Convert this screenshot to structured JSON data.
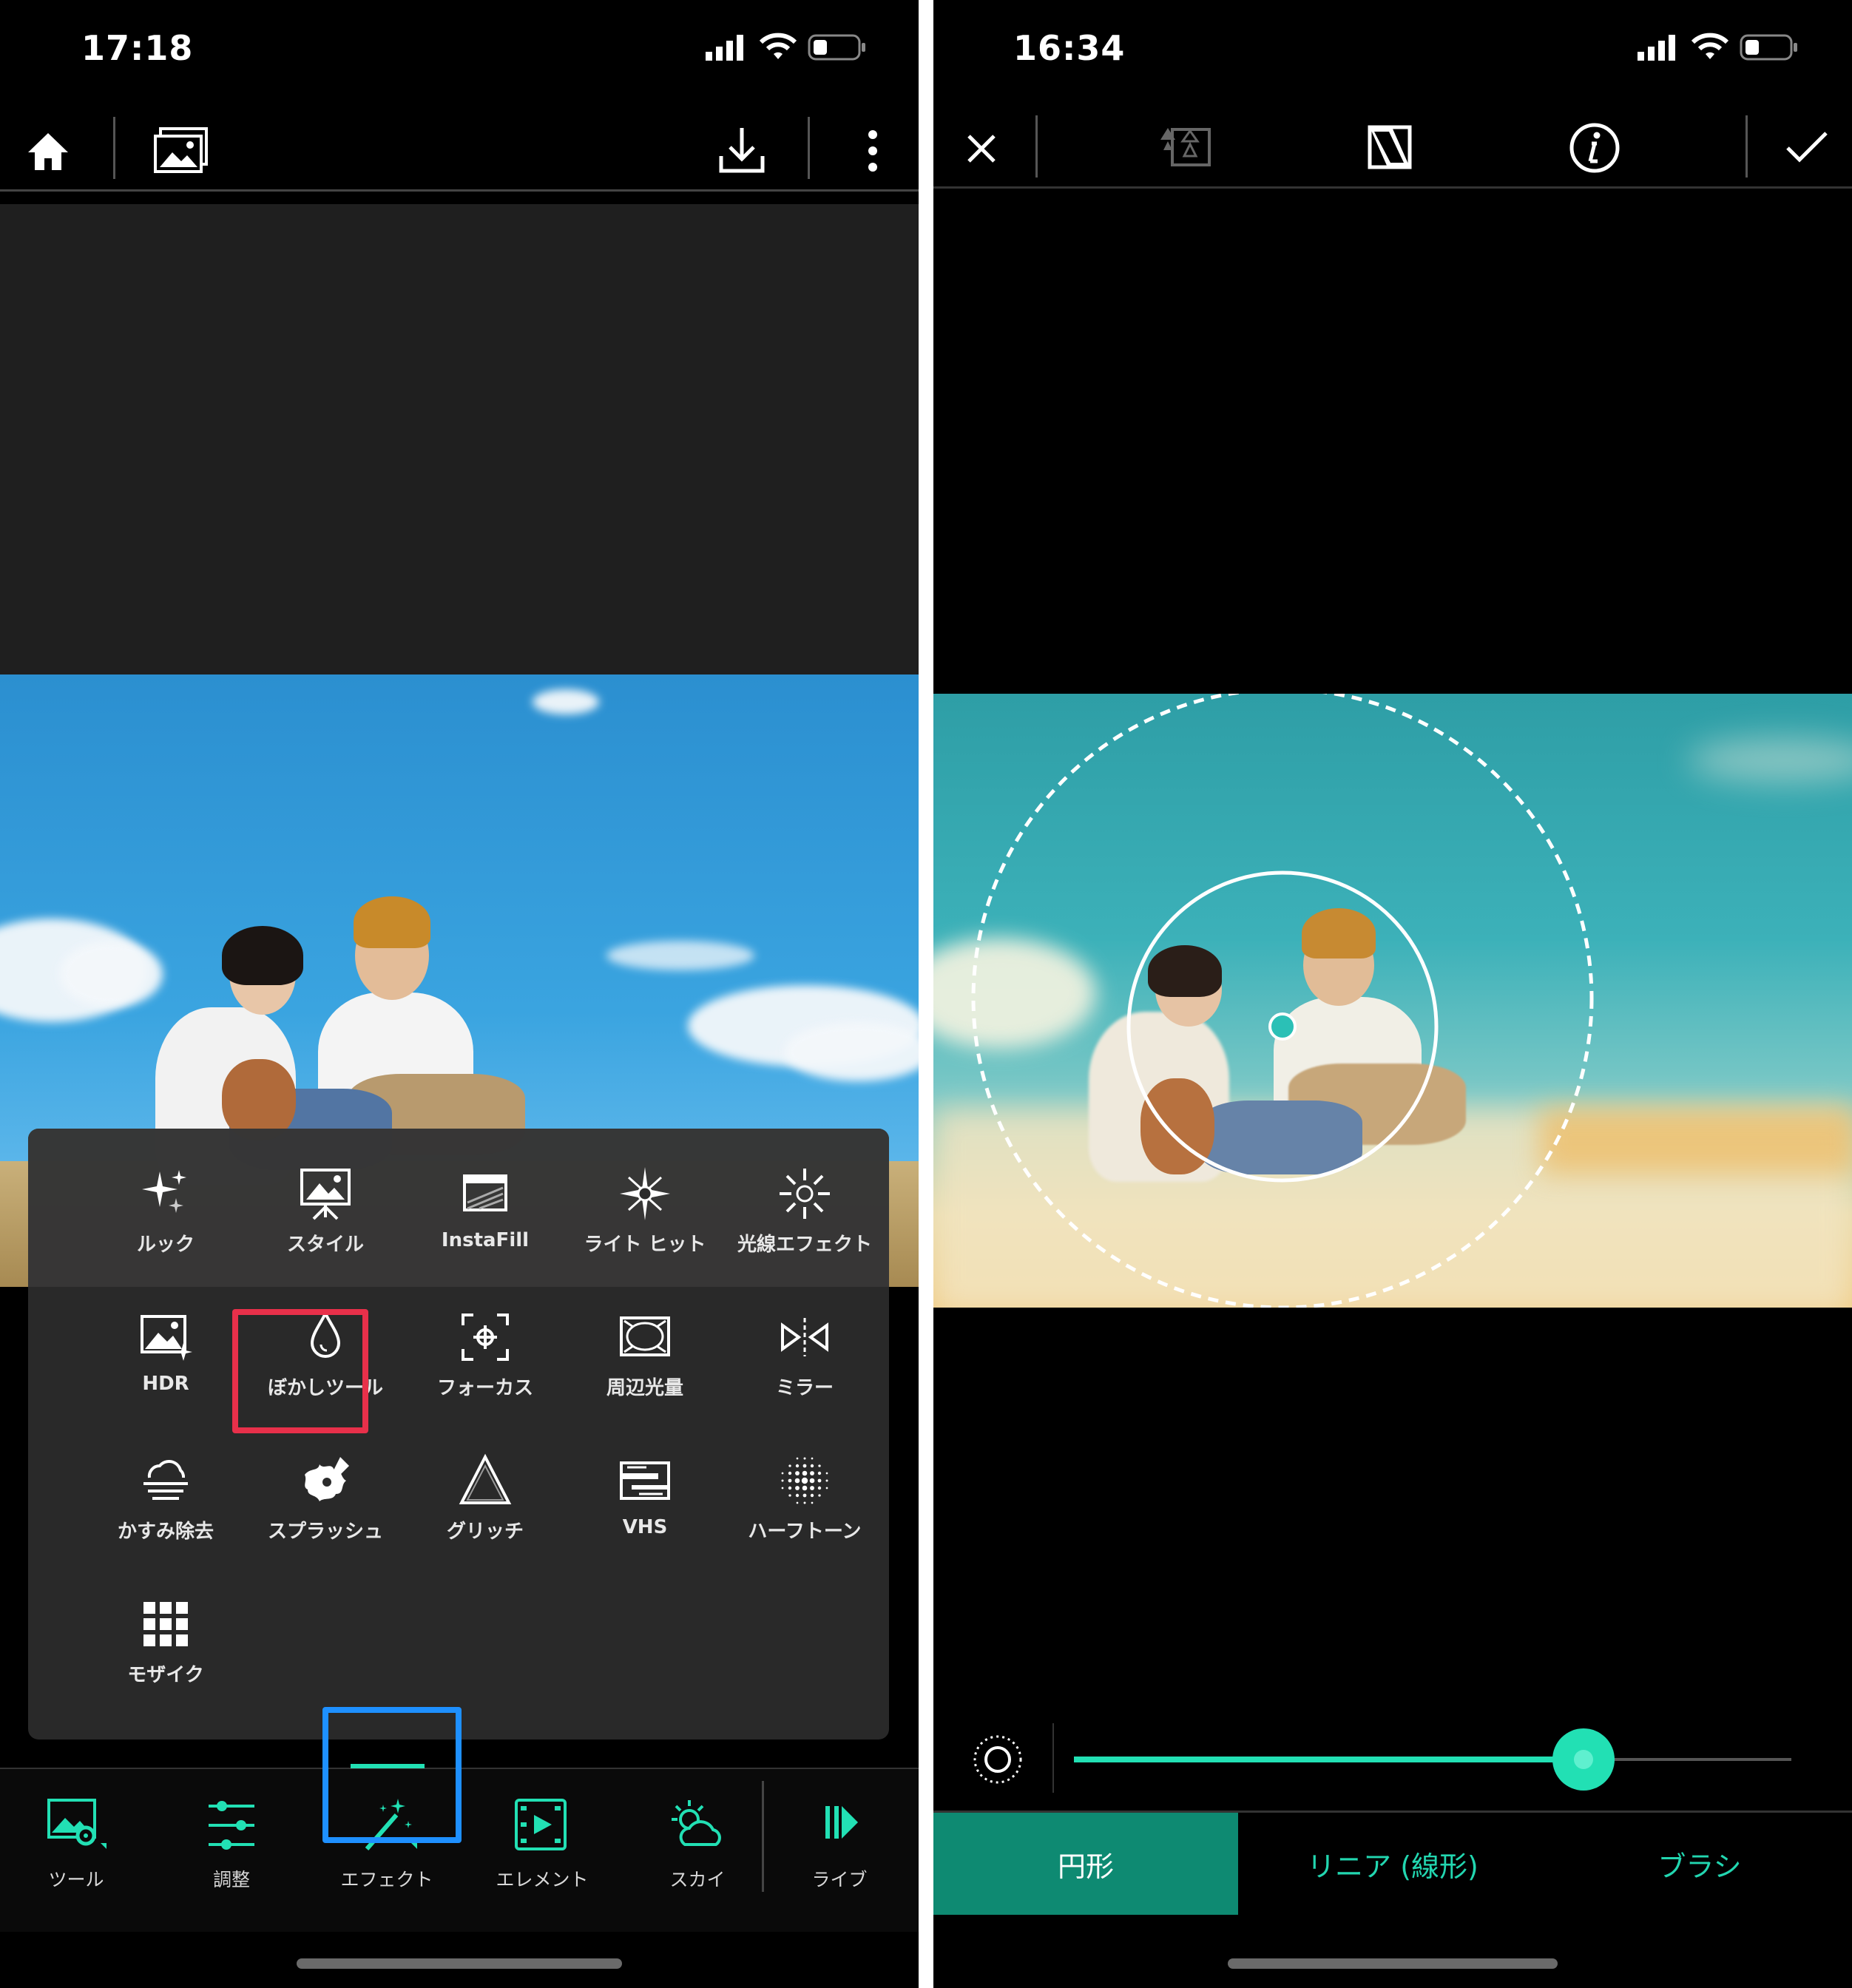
{
  "left": {
    "status": {
      "time": "17:18"
    },
    "effects_row1": [
      {
        "icon": "sparkle-icon",
        "label": "ルック"
      },
      {
        "icon": "easel-icon",
        "label": "スタイル"
      },
      {
        "icon": "instafill-icon",
        "label": "InstaFill"
      },
      {
        "icon": "light-hit-icon",
        "label": "ライト ヒット"
      },
      {
        "icon": "light-rays-icon",
        "label": "光線エフェクト"
      }
    ],
    "effects_row2": [
      {
        "icon": "hdr-icon",
        "label": "HDR"
      },
      {
        "icon": "drop-icon",
        "label": "ぼかしツール"
      },
      {
        "icon": "focus-icon",
        "label": "フォーカス"
      },
      {
        "icon": "vignette-icon",
        "label": "周辺光量"
      },
      {
        "icon": "mirror-icon",
        "label": "ミラー"
      }
    ],
    "effects_row3": [
      {
        "icon": "dehaze-icon",
        "label": "かすみ除去"
      },
      {
        "icon": "splash-icon",
        "label": "スプラッシュ"
      },
      {
        "icon": "glitch-icon",
        "label": "グリッチ"
      },
      {
        "icon": "vhs-icon",
        "label": "VHS"
      },
      {
        "icon": "halftone-icon",
        "label": "ハーフトーン"
      }
    ],
    "effects_row4": [
      {
        "icon": "mosaic-icon",
        "label": "モザイク"
      }
    ],
    "bottom_nav": [
      {
        "icon": "tools-icon",
        "label": "ツール"
      },
      {
        "icon": "adjust-icon",
        "label": "調整"
      },
      {
        "icon": "magic-wand-icon",
        "label": "エフェクト"
      },
      {
        "icon": "element-icon",
        "label": "エレメント"
      },
      {
        "icon": "sky-icon",
        "label": "スカイ"
      },
      {
        "icon": "live-icon",
        "label": "ライブ"
      }
    ],
    "active_nav": "エフェクト",
    "highlighted_effect": "ぼかしツール"
  },
  "right": {
    "status": {
      "time": "16:34"
    },
    "slider": {
      "value": 0.71
    },
    "modes": [
      {
        "label": "円形",
        "active": true
      },
      {
        "label": "リニア (線形)",
        "active": false
      },
      {
        "label": "ブラシ",
        "active": false
      }
    ],
    "accent_color": "#22e0b4",
    "active_mode_bg": "#0e8a72"
  }
}
